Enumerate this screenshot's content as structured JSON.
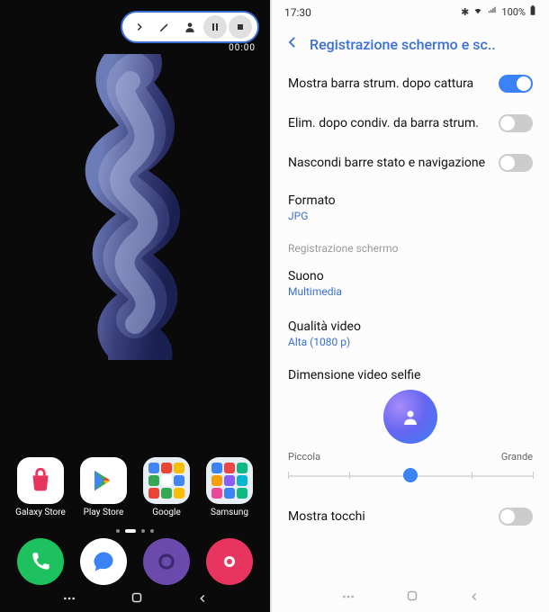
{
  "left": {
    "timer": "00:00",
    "apps": [
      {
        "label": "Galaxy Store",
        "name": "galaxy-store-icon"
      },
      {
        "label": "Play Store",
        "name": "play-store-icon"
      },
      {
        "label": "Google",
        "name": "google-folder-icon"
      },
      {
        "label": "Samsung",
        "name": "samsung-folder-icon"
      }
    ]
  },
  "right": {
    "status": {
      "time": "17:30",
      "battery": "100%"
    },
    "title": "Registrazione schermo e sc..",
    "rows": {
      "show_toolbar": {
        "label": "Mostra barra strum. dopo cattura",
        "on": true
      },
      "delete_after_share": {
        "label": "Elim. dopo condiv. da barra strum.",
        "on": false
      },
      "hide_bars": {
        "label": "Nascondi barre stato e navigazione",
        "on": false
      },
      "format": {
        "label": "Formato",
        "value": "JPG"
      },
      "section": "Registrazione schermo",
      "sound": {
        "label": "Suono",
        "value": "Multimedia"
      },
      "quality": {
        "label": "Qualità video",
        "value": "Alta (1080 p)"
      },
      "selfie": {
        "label": "Dimensione video selfie",
        "min_label": "Piccola",
        "max_label": "Grande"
      },
      "show_touches": {
        "label": "Mostra tocchi",
        "on": false
      }
    }
  }
}
